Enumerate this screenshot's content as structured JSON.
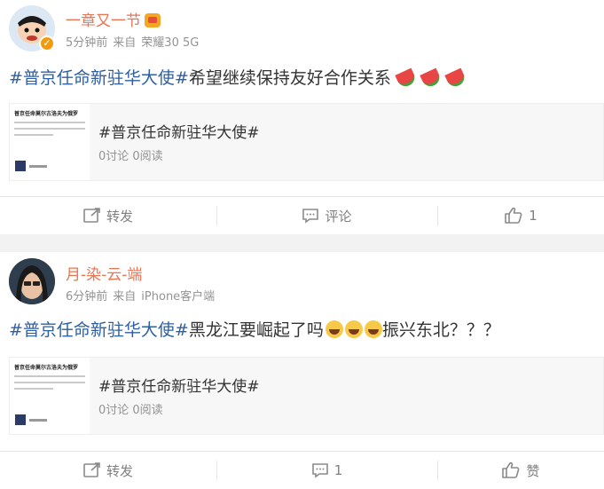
{
  "posts": [
    {
      "username": "一章又一节",
      "time": "5分钟前",
      "source_prefix": "来自",
      "device": "荣耀30 5G",
      "hashtag": "#普京任命新驻华大使#",
      "text": "希望继续保持友好合作关系",
      "emojis": [
        "watermelon-emoji",
        "watermelon-emoji",
        "watermelon-emoji"
      ],
      "card": {
        "title": "#普京任命新驻华大使#",
        "stats": "0讨论 0阅读",
        "thumb_title": "普京任命莫尔古洛夫为俄罗"
      },
      "actions": {
        "repost": "转发",
        "comment": "评论",
        "like": "1"
      }
    },
    {
      "username": "月-染-云-端",
      "time": "6分钟前",
      "source_prefix": "来自",
      "device": "iPhone客户端",
      "hashtag": "#普京任命新驻华大使#",
      "text": "黑龙江要崛起了吗",
      "text_after": "振兴东北？？？",
      "emojis": [
        "laughing-emoji",
        "laughing-emoji",
        "laughing-emoji"
      ],
      "card": {
        "title": "#普京任命新驻华大使#",
        "stats": "0讨论 0阅读",
        "thumb_title": "普京任命莫尔古洛夫为俄罗"
      },
      "actions": {
        "repost": "转发",
        "comment": "1",
        "like": "赞"
      }
    }
  ],
  "colors": {
    "username": "#eb7350",
    "hashtag": "#2d5fa6",
    "meta": "#939393",
    "action": "#808080"
  }
}
